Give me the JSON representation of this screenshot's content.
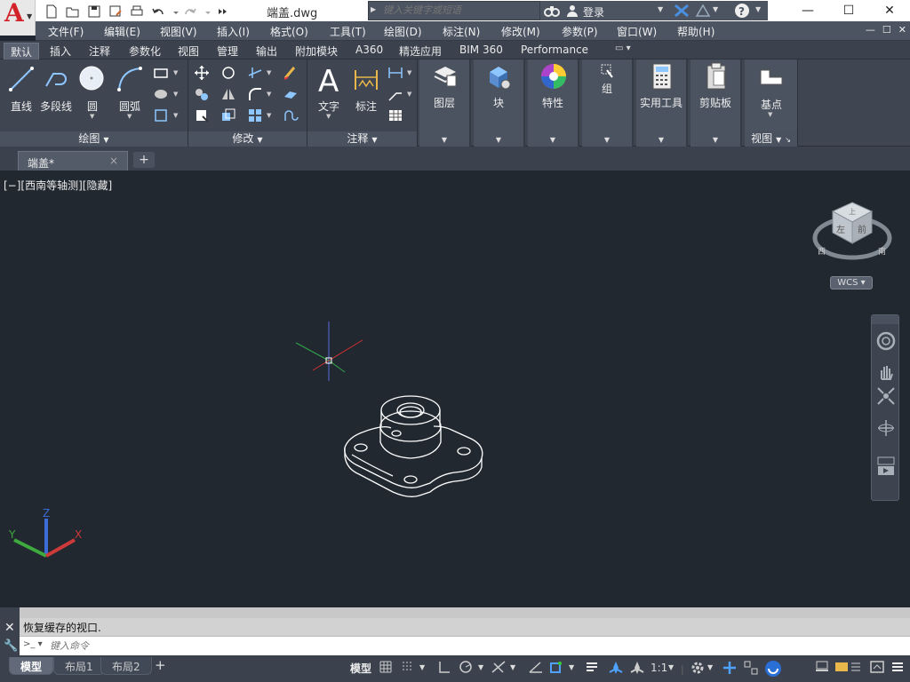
{
  "app": {
    "title": "端盖.dwg",
    "logo_letter": "A",
    "colors": {
      "accent": "#d2232a",
      "canvas": "#212830",
      "ribbon": "#3f4652",
      "header_dark": "#4c5462"
    }
  },
  "search": {
    "placeholder": "键入关键字或短语"
  },
  "account": {
    "sign_in_label": "登录"
  },
  "window_controls": {
    "minimize": "—",
    "maximize": "☐",
    "close": "✕"
  },
  "menu": {
    "items": [
      "文件(F)",
      "编辑(E)",
      "视图(V)",
      "插入(I)",
      "格式(O)",
      "工具(T)",
      "绘图(D)",
      "标注(N)",
      "修改(M)",
      "参数(P)",
      "窗口(W)",
      "帮助(H)"
    ]
  },
  "ribbon_tabs": {
    "items": [
      "默认",
      "插入",
      "注释",
      "参数化",
      "视图",
      "管理",
      "输出",
      "附加模块",
      "A360",
      "精选应用",
      "BIM 360",
      "Performance"
    ],
    "active": "默认"
  },
  "ribbon": {
    "draw": {
      "title": "绘图",
      "line": "直线",
      "polyline": "多段线",
      "circle": "圆",
      "arc": "圆弧"
    },
    "modify": {
      "title": "修改"
    },
    "annotation": {
      "title": "注释",
      "text": "文字",
      "dimension": "标注"
    },
    "layers": {
      "label": "图层"
    },
    "block": {
      "label": "块"
    },
    "properties": {
      "label": "特性"
    },
    "group": {
      "label": "组"
    },
    "utilities": {
      "label": "实用工具"
    },
    "clipboard": {
      "label": "剪贴板"
    },
    "view": {
      "base_label": "基点",
      "title": "视图"
    }
  },
  "file_tab": {
    "label": "端盖*",
    "close": "×",
    "new": "+"
  },
  "viewport": {
    "label": "[−][西南等轴测][隐藏]",
    "viewcube": {
      "left_face": "左",
      "front_face": "前",
      "top_face": "上",
      "compass_w": "西",
      "compass_s": "南"
    },
    "wcs_label": "WCS",
    "ucs": {
      "x": "X",
      "y": "Y",
      "z": "Z"
    }
  },
  "command": {
    "history": "恢复缓存的视口.",
    "placeholder": "键入命令",
    "prompt_icon": ">_"
  },
  "layout_tabs": {
    "items": [
      "模型",
      "布局1",
      "布局2"
    ],
    "active": "模型",
    "add": "+"
  },
  "status": {
    "model_label": "模型",
    "scale": "1:1"
  }
}
